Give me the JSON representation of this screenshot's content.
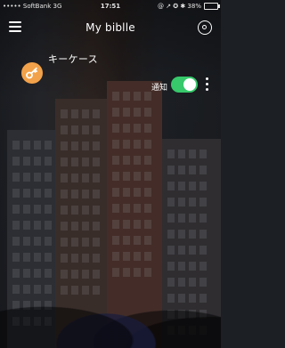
{
  "status_bar": {
    "carrier": "••••• SoftBank  3G",
    "time": "17:51",
    "right": "@ ↗ ✪ ✱ 38%",
    "battery_percent": 38
  },
  "header": {
    "title": "My biblle",
    "menu_icon": "hamburger-menu-icon",
    "right_icon": "radar-icon"
  },
  "items": [
    {
      "name": "キーケース",
      "icon": "key-icon",
      "notify_label": "通知",
      "notify_on": true,
      "colors": {
        "icon_bg": "#f2a24a",
        "toggle_on": "#37c86b"
      }
    }
  ]
}
